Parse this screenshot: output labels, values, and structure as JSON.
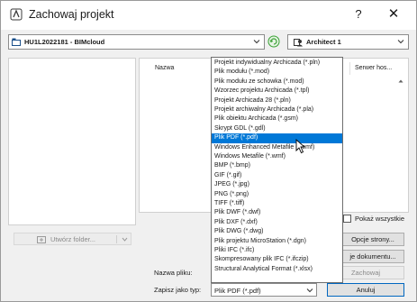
{
  "window": {
    "title": "Zachowaj projekt",
    "help_glyph": "?",
    "close_glyph": "✕"
  },
  "location": {
    "value": "HU1L2022181 - BIMcloud",
    "icon": "bimcloud-server-icon"
  },
  "view": {
    "value": "Architect 1",
    "icon": "user-role-icon"
  },
  "file_list": {
    "columns": [
      "Nazwa",
      "Serwer hos..."
    ]
  },
  "show_all_label": "Pokaż wszystkie",
  "new_folder_label": "Utwórz folder...",
  "buttons": {
    "options": "Opcje strony...",
    "docs": "je dokumentu...",
    "save": "Zachowaj",
    "cancel": "Anuluj"
  },
  "filename_label": "Nazwa pliku:",
  "filetype_label": "Zapisz jako typ:",
  "filetype_value": "Plik PDF (*.pdf)",
  "file_types": [
    "Projekt indywidualny Archicada (*.pln)",
    "Plik modułu (*.mod)",
    "Plik modułu ze schowka (*.mod)",
    "Wzorzec projektu Archicada (*.tpl)",
    "Projekt Archicada 28 (*.pln)",
    "Projekt archiwalny Archicada (*.pla)",
    "Plik obiektu Archicada (*.gsm)",
    "Skrypt GDL (*.gdl)",
    "Plik PDF (*.pdf)",
    "Windows Enhanced Metafile (*.emf)",
    "Windows Metafile (*.wmf)",
    "BMP (*.bmp)",
    "GIF (*.gif)",
    "JPEG (*.jpg)",
    "PNG (*.png)",
    "TIFF (*.tiff)",
    "Plik DWF (*.dwf)",
    "Plik DXF (*.dxf)",
    "Plik DWG (*.dwg)",
    "Plik projektu MicroStation (*.dgn)",
    "Pliki IFC (*.ifc)",
    "Skompresowany plik IFC (*.ifczip)",
    "Structural Analytical Format (*.xlsx)"
  ],
  "selected_index": 8,
  "colors": {
    "selection": "#0078d7",
    "accent_border": "#0067c0",
    "bimcloud_green": "#3aa135"
  }
}
